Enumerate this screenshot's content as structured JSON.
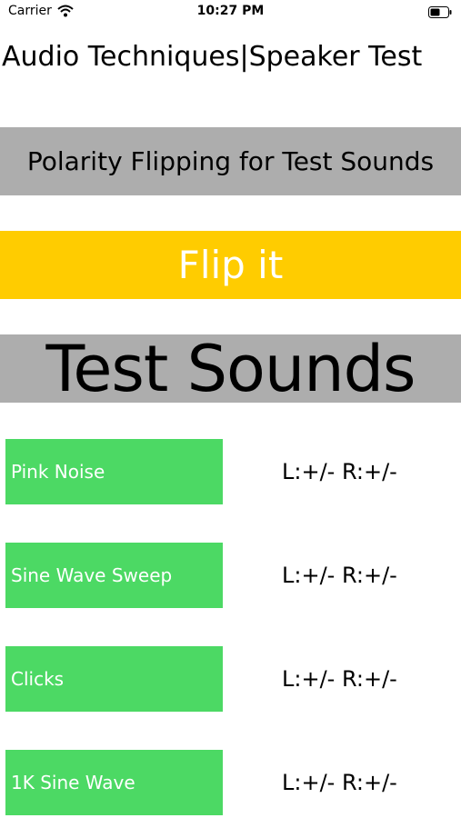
{
  "status_bar": {
    "carrier": "Carrier",
    "time": "10:27 PM"
  },
  "app_title": "Audio Techniques|Speaker Test",
  "polarity_label": "Polarity Flipping for Test Sounds",
  "flip_button": "Flip it",
  "section_title": "Test Sounds",
  "sounds": [
    {
      "name": "Pink Noise",
      "polarity": "L:+/- R:+/-"
    },
    {
      "name": "Sine Wave Sweep",
      "polarity": "L:+/- R:+/-"
    },
    {
      "name": "Clicks",
      "polarity": "L:+/- R:+/-"
    },
    {
      "name": "1K Sine Wave",
      "polarity": "L:+/- R:+/-"
    }
  ],
  "colors": {
    "gray_band": "#adadad",
    "flip_yellow": "#ffcc00",
    "sound_green": "#4cd964"
  },
  "icons": [
    "wifi-icon",
    "battery-icon"
  ]
}
